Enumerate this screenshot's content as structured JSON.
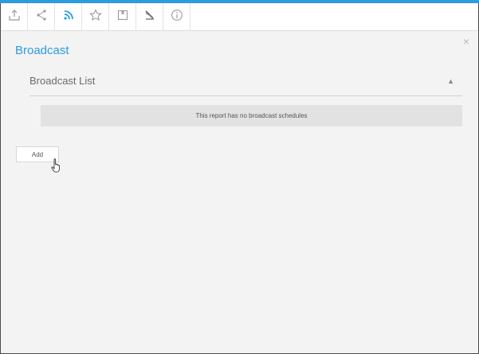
{
  "toolbar": {
    "buttons": [
      {
        "icon": "export-icon",
        "name": "export-button"
      },
      {
        "icon": "share-icon",
        "name": "share-button"
      },
      {
        "icon": "broadcast-rss-icon",
        "name": "broadcast-button",
        "active": true
      },
      {
        "icon": "star-icon",
        "name": "favourite-button"
      },
      {
        "icon": "bookmark-icon",
        "name": "bookmark-button"
      },
      {
        "icon": "satellite-icon",
        "name": "publish-button"
      },
      {
        "icon": "info-icon",
        "name": "info-button"
      }
    ],
    "accent_color": "#2d9be0"
  },
  "panel": {
    "title": "Broadcast",
    "close_label": "×",
    "section_title": "Broadcast List",
    "collapse_label": "▲",
    "empty_message": "This report has no broadcast schedules",
    "add_label": "Add"
  }
}
